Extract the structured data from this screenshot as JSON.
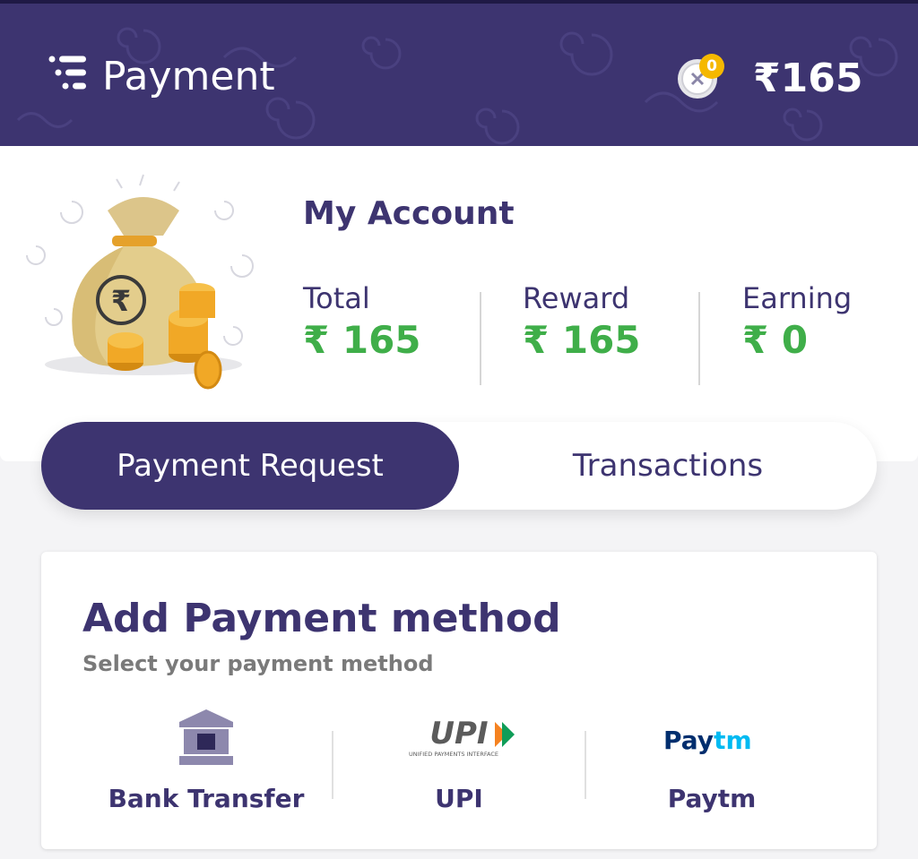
{
  "header": {
    "title": "Payment",
    "coin_count": "0",
    "balance": "₹165"
  },
  "account": {
    "title": "My Account",
    "stats": [
      {
        "label": "Total",
        "value": "₹ 165"
      },
      {
        "label": "Reward",
        "value": "₹ 165"
      },
      {
        "label": "Earning",
        "value": "₹ 0"
      }
    ]
  },
  "tabs": [
    {
      "label": "Payment Request",
      "active": true
    },
    {
      "label": "Transactions",
      "active": false
    }
  ],
  "payment_method": {
    "title": "Add Payment method",
    "subtitle": "Select your payment method",
    "methods": [
      {
        "label": "Bank Transfer",
        "icon": "bank-icon"
      },
      {
        "label": "UPI",
        "icon": "upi-logo",
        "logo_text": "UPI",
        "logo_subtext": "UNIFIED PAYMENTS INTERFACE"
      },
      {
        "label": "Paytm",
        "icon": "paytm-logo",
        "logo_text_a": "Pay",
        "logo_text_b": "tm"
      }
    ]
  },
  "colors": {
    "primary": "#3d3470",
    "money_green": "#3fae49",
    "coin_gold": "#f5b800",
    "upi_orange": "#f58220",
    "upi_green": "#0f9d58",
    "paytm_dark": "#002e6e",
    "paytm_light": "#00baf2"
  }
}
